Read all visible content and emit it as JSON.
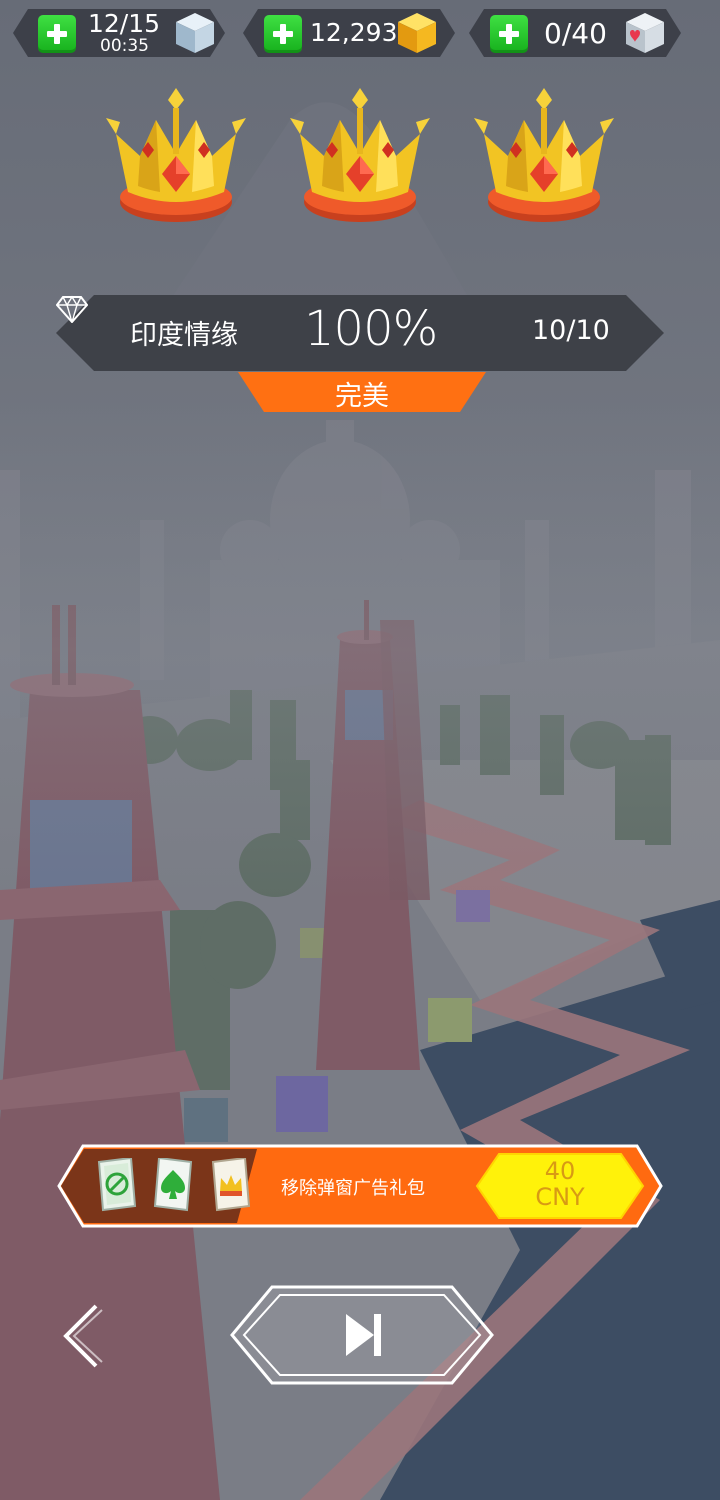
{
  "hud": {
    "lives": {
      "value": "12/15",
      "timer": "00:35"
    },
    "gems": {
      "value": "12,293"
    },
    "hearts": {
      "value": "0/40"
    }
  },
  "result": {
    "crowns_earned": 3,
    "crowns_total": 3,
    "level_name": "印度情缘",
    "progress_text": "100%",
    "gems_collected": "10/10",
    "rating_label": "完美"
  },
  "offer": {
    "title": "移除弹窗广告礼包",
    "price_amount": "40",
    "price_currency": "CNY",
    "items": [
      "no-ads-card-icon",
      "spade-card-icon",
      "crown-card-icon"
    ]
  },
  "navigation": {
    "back_icon": "chevron-left-icon",
    "next_icon": "skip-next-icon"
  },
  "colors": {
    "accent_orange": "#ff7012",
    "price_yellow": "#fff20a",
    "plus_green": "#22c426",
    "crown_gold": "#f0c020",
    "offer_brown": "#7b3519"
  }
}
